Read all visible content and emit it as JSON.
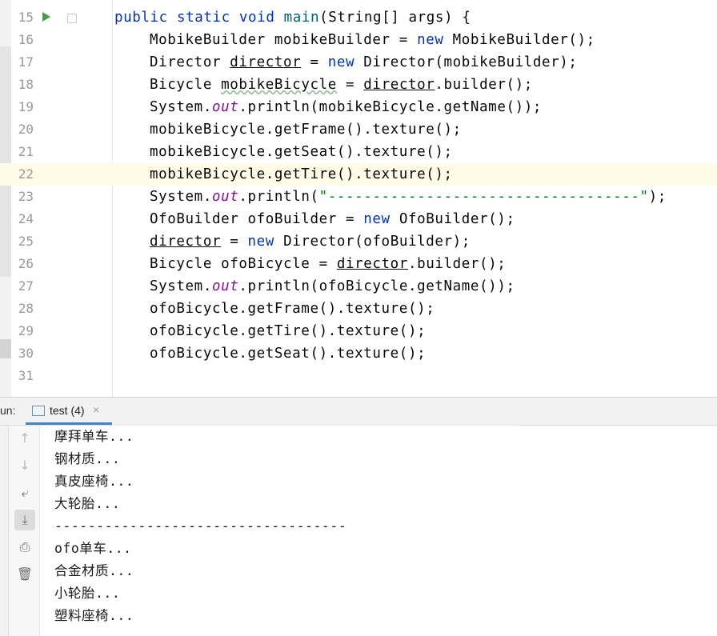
{
  "editor": {
    "lines": [
      {
        "num": "15",
        "tokens": [
          [
            "kw",
            "public "
          ],
          [
            "kw",
            "static "
          ],
          [
            "kw",
            "void "
          ],
          [
            "mth",
            "main"
          ],
          [
            "",
            "(String[] args) {"
          ]
        ],
        "indent": 1
      },
      {
        "num": "16",
        "tokens": [
          [
            "",
            "MobikeBuilder mobikeBuilder = "
          ],
          [
            "kw",
            "new "
          ],
          [
            "",
            "MobikeBuilder();"
          ]
        ],
        "indent": 2
      },
      {
        "num": "17",
        "tokens": [
          [
            "",
            "Director "
          ],
          [
            "ul",
            "director"
          ],
          [
            "",
            " = "
          ],
          [
            "kw",
            "new "
          ],
          [
            "",
            "Director(mobikeBuilder);"
          ]
        ],
        "indent": 2
      },
      {
        "num": "18",
        "tokens": [
          [
            "",
            "Bicycle "
          ],
          [
            "wavy",
            "mobikeBicycle"
          ],
          [
            "",
            " = "
          ],
          [
            "ul",
            "director"
          ],
          [
            "",
            ".builder();"
          ]
        ],
        "indent": 2
      },
      {
        "num": "19",
        "tokens": [
          [
            "",
            "System."
          ],
          [
            "fld",
            "out"
          ],
          [
            "",
            ".println(mobikeBicycle.getName());"
          ]
        ],
        "indent": 2
      },
      {
        "num": "20",
        "tokens": [
          [
            "",
            "mobikeBicycle.getFrame().texture();"
          ]
        ],
        "indent": 2
      },
      {
        "num": "21",
        "tokens": [
          [
            "",
            "mobikeBicycle.getSeat().texture();"
          ]
        ],
        "indent": 2
      },
      {
        "num": "22",
        "tokens": [
          [
            "",
            "mobikeBicycle.getTire().texture();"
          ]
        ],
        "indent": 2
      },
      {
        "num": "23",
        "tokens": [
          [
            "",
            "System."
          ],
          [
            "fld",
            "out"
          ],
          [
            "",
            ".println("
          ],
          [
            "str",
            "\"-----------------------------------\""
          ],
          [
            "",
            ");"
          ]
        ],
        "indent": 2
      },
      {
        "num": "24",
        "tokens": [
          [
            "",
            "OfoBuilder ofoBuilder = "
          ],
          [
            "kw",
            "new "
          ],
          [
            "",
            "OfoBuilder();"
          ]
        ],
        "indent": 2
      },
      {
        "num": "25",
        "tokens": [
          [
            "ul",
            "director"
          ],
          [
            "",
            " = "
          ],
          [
            "kw",
            "new "
          ],
          [
            "",
            "Director(ofoBuilder);"
          ]
        ],
        "indent": 2
      },
      {
        "num": "26",
        "tokens": [
          [
            "",
            "Bicycle ofoBicycle = "
          ],
          [
            "ul",
            "director"
          ],
          [
            "",
            ".builder();"
          ]
        ],
        "indent": 2
      },
      {
        "num": "27",
        "tokens": [
          [
            "",
            "System."
          ],
          [
            "fld",
            "out"
          ],
          [
            "",
            ".println(ofoBicycle.getName());"
          ]
        ],
        "indent": 2
      },
      {
        "num": "28",
        "tokens": [
          [
            "",
            "ofoBicycle.getFrame().texture();"
          ]
        ],
        "indent": 2
      },
      {
        "num": "29",
        "tokens": [
          [
            "",
            "ofoBicycle.getTire().texture();"
          ]
        ],
        "indent": 2
      },
      {
        "num": "30",
        "tokens": [
          [
            "",
            "ofoBicycle.getSeat().texture();"
          ]
        ],
        "indent": 2
      },
      {
        "num": "31",
        "tokens": [],
        "indent": 0
      }
    ],
    "current_line": "22"
  },
  "run_panel": {
    "label": "un:",
    "tab_label": "test (4)",
    "tab_close": "×",
    "output": [
      "摩拜单车...",
      "钢材质...",
      "真皮座椅...",
      "大轮胎...",
      "-----------------------------------",
      "ofo单车...",
      "合金材质...",
      "小轮胎...",
      "塑料座椅..."
    ]
  },
  "toolbar": {
    "buttons": [
      {
        "name": "up-arrow-icon",
        "glyph": "↑",
        "dim": true
      },
      {
        "name": "down-arrow-icon",
        "glyph": "↓",
        "dim": true
      },
      {
        "name": "soft-wrap-icon",
        "glyph": "⤶",
        "dim": false
      },
      {
        "name": "scroll-to-end-icon",
        "glyph": "⤓",
        "dim": false,
        "active": true
      },
      {
        "name": "print-icon",
        "glyph": "⎙",
        "dim": false
      },
      {
        "name": "trash-icon",
        "glyph": "🗑",
        "dim": false
      }
    ]
  },
  "colors": {
    "keyword": "#0033b3",
    "method": "#00627a",
    "field": "#871094",
    "string": "#067d17",
    "current_line_bg": "#fefbe6",
    "tab_underline": "#4083c9"
  }
}
